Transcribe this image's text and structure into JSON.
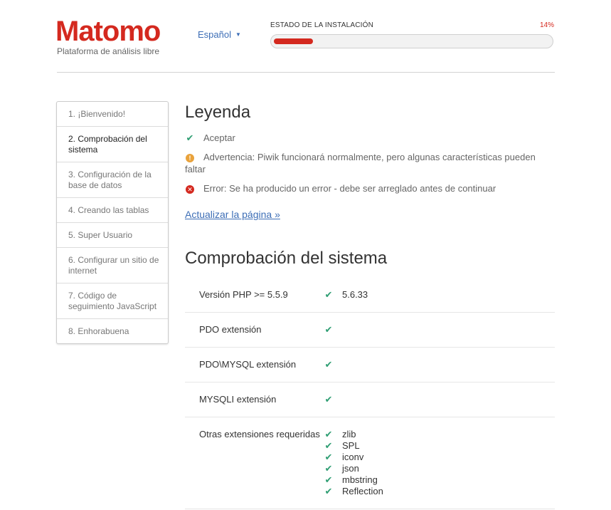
{
  "header": {
    "logo_text": "Matomo",
    "tagline": "Plataforma de análisis libre",
    "language": "Español",
    "progress_label": "ESTADO DE LA INSTALACIÓN",
    "progress_percent_text": "14%",
    "progress_fraction": 0.14
  },
  "steps": [
    {
      "label": "1. ¡Bienvenido!",
      "active": false
    },
    {
      "label": "2. Comprobación del sistema",
      "active": true
    },
    {
      "label": "3. Configuración de la base de datos",
      "active": false
    },
    {
      "label": "4. Creando las tablas",
      "active": false
    },
    {
      "label": "5. Super Usuario",
      "active": false
    },
    {
      "label": "6. Configurar un sitio de internet",
      "active": false
    },
    {
      "label": "7. Código de seguimiento JavaScript",
      "active": false
    },
    {
      "label": "8. Enhorabuena",
      "active": false
    }
  ],
  "legend": {
    "title": "Leyenda",
    "accept": "Aceptar",
    "warning": "Advertencia: Piwik funcionará normalmente, pero algunas características pueden faltar",
    "error": "Error: Se ha producido un error - debe ser arreglado antes de continuar",
    "refresh_link": "Actualizar la página »"
  },
  "system_check": {
    "title": "Comprobación del sistema",
    "rows": [
      {
        "requirement": "Versión PHP >= 5.5.9",
        "results": [
          "5.6.33"
        ]
      },
      {
        "requirement": "PDO extensión",
        "results": [
          ""
        ]
      },
      {
        "requirement": "PDO\\MYSQL extensión",
        "results": [
          ""
        ]
      },
      {
        "requirement": "MYSQLI extensión",
        "results": [
          ""
        ]
      },
      {
        "requirement": "Otras extensiones requeridas",
        "results": [
          "zlib",
          "SPL",
          "iconv",
          "json",
          "mbstring",
          "Reflection"
        ]
      }
    ]
  },
  "icons": {
    "ok": "check-icon",
    "warning": "warning-icon",
    "error": "error-icon",
    "caret": "caret-down-icon"
  },
  "colors": {
    "brand_red": "#d4291f",
    "link_blue": "#3d6eb6",
    "ok_green": "#2f9e73",
    "warning_orange": "#e9a23b"
  }
}
